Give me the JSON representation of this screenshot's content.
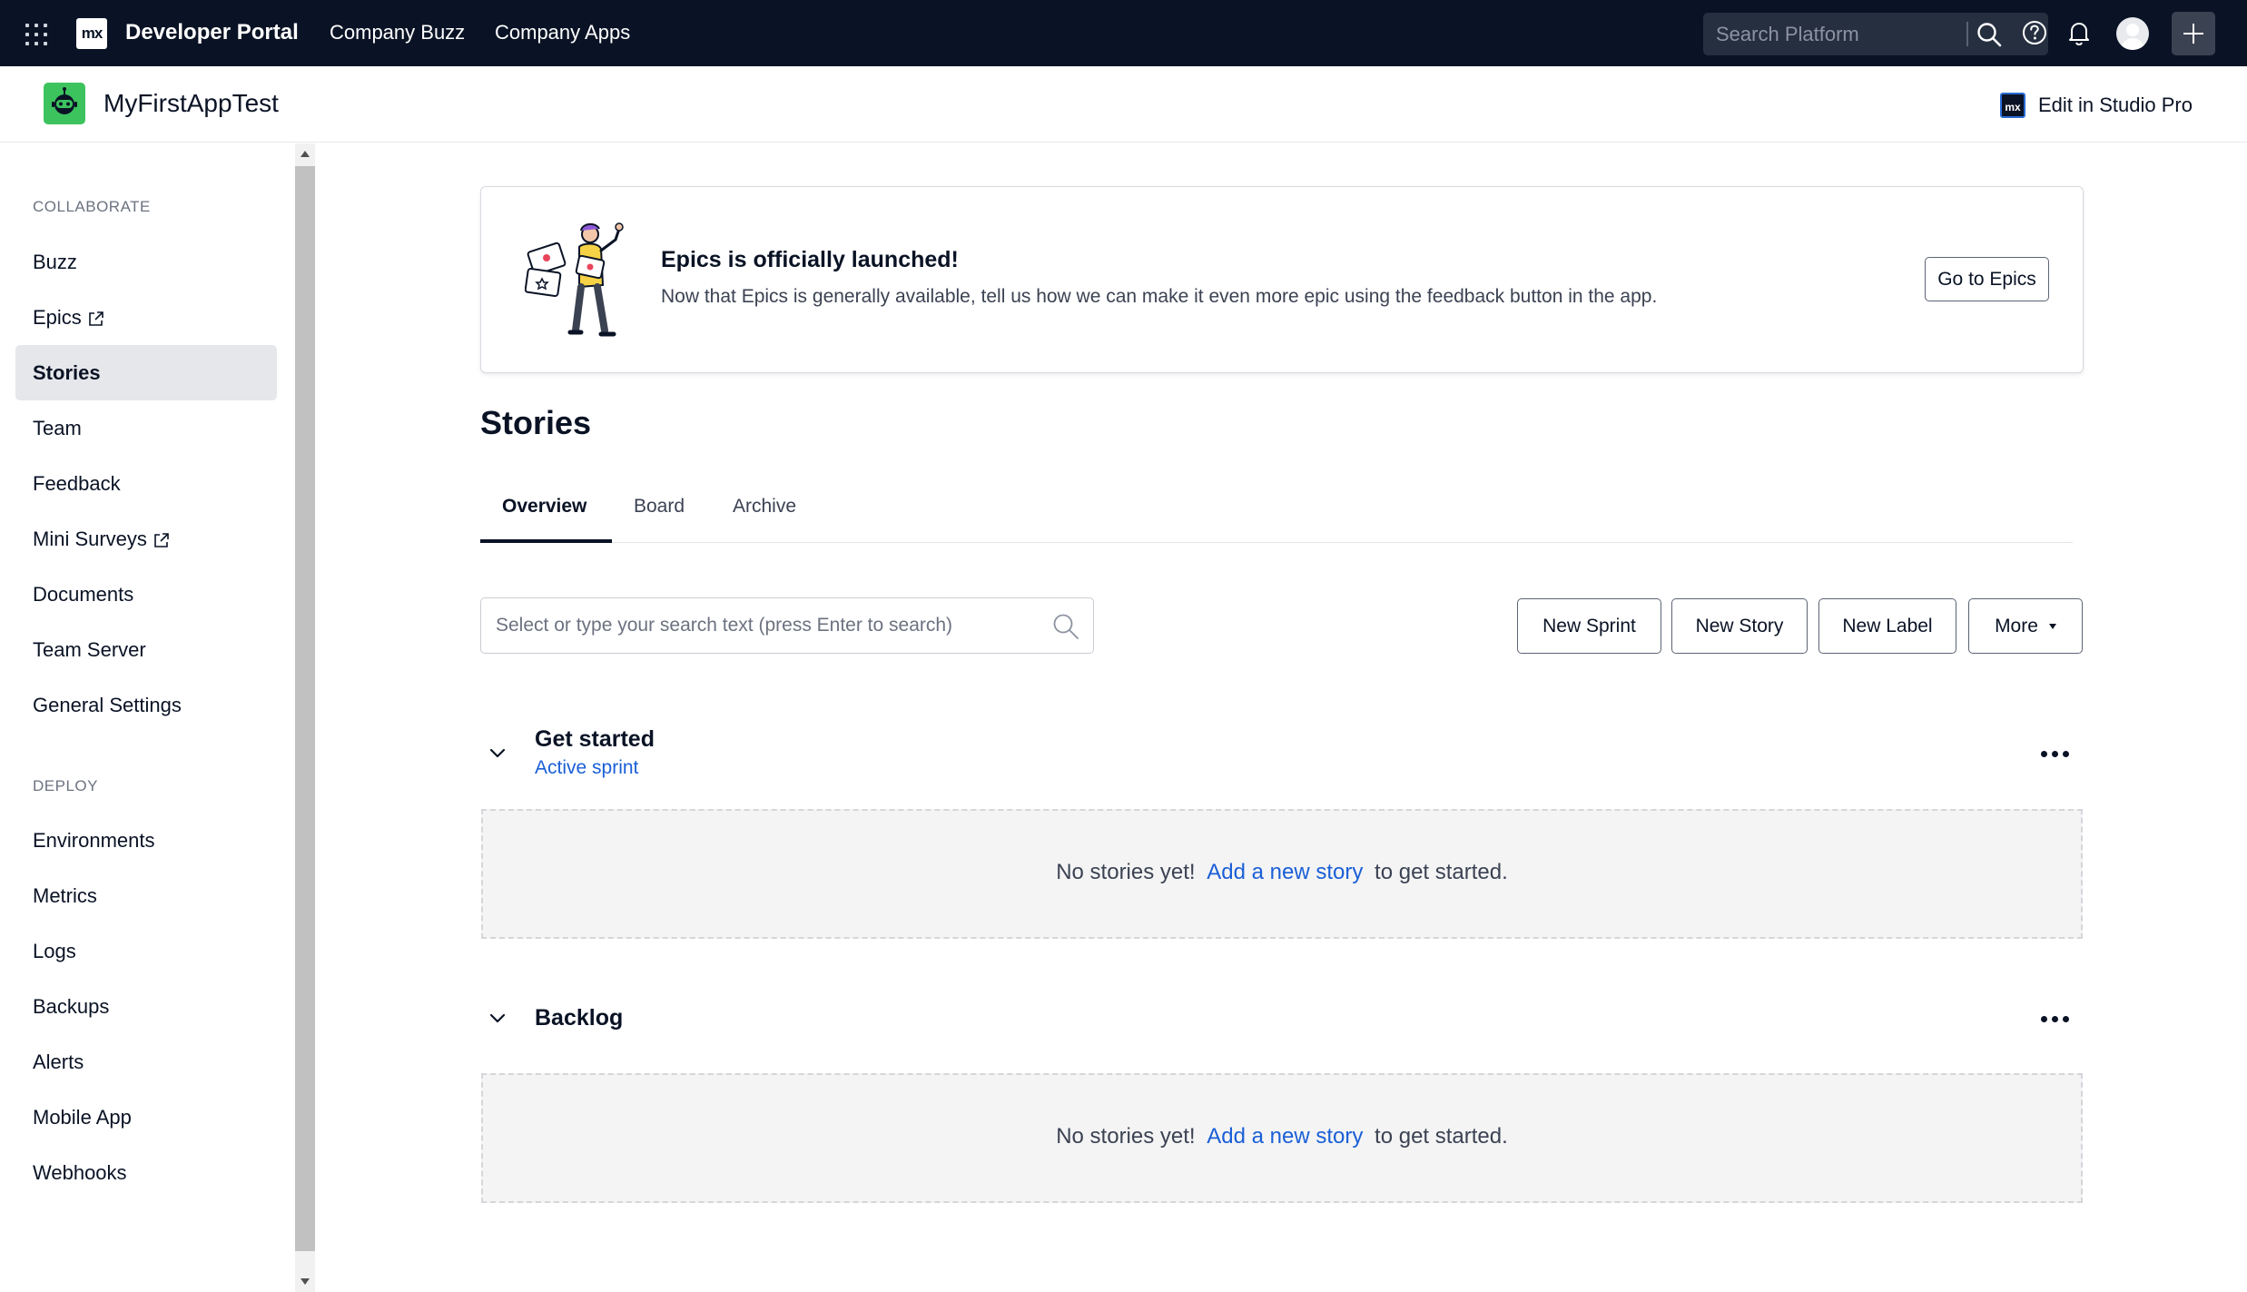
{
  "topbar": {
    "portal_title": "Developer Portal",
    "logo_text": "mx",
    "nav_links": [
      "Company Buzz",
      "Company Apps"
    ],
    "search_placeholder": "Search Platform",
    "icons": [
      "apps-grid-icon",
      "search-icon",
      "help-icon",
      "bell-icon",
      "avatar",
      "plus-icon"
    ]
  },
  "app": {
    "name": "MyFirstAppTest",
    "studio_link": "Edit in Studio Pro",
    "studio_logo_text": "mx"
  },
  "sidebar": {
    "sections": [
      {
        "title": "COLLABORATE",
        "items": [
          {
            "label": "Buzz",
            "external": false,
            "active": false
          },
          {
            "label": "Epics",
            "external": true,
            "active": false
          },
          {
            "label": "Stories",
            "external": false,
            "active": true
          },
          {
            "label": "Team",
            "external": false,
            "active": false
          },
          {
            "label": "Feedback",
            "external": false,
            "active": false
          },
          {
            "label": "Mini Surveys",
            "external": true,
            "active": false
          },
          {
            "label": "Documents",
            "external": false,
            "active": false
          },
          {
            "label": "Team Server",
            "external": false,
            "active": false
          },
          {
            "label": "General Settings",
            "external": false,
            "active": false
          }
        ]
      },
      {
        "title": "DEPLOY",
        "items": [
          {
            "label": "Environments"
          },
          {
            "label": "Metrics"
          },
          {
            "label": "Logs"
          },
          {
            "label": "Backups"
          },
          {
            "label": "Alerts"
          },
          {
            "label": "Mobile App"
          },
          {
            "label": "Webhooks"
          }
        ]
      }
    ]
  },
  "banner": {
    "title": "Epics is officially launched!",
    "text": "Now that Epics is generally available, tell us how we can make it even more epic using the feedback button in the app.",
    "button": "Go to Epics"
  },
  "page": {
    "title": "Stories",
    "tabs": [
      "Overview",
      "Board",
      "Archive"
    ],
    "active_tab": "Overview",
    "search_placeholder": "Select or type your search text (press Enter to search)",
    "actions": [
      "New Sprint",
      "New Story",
      "New Label",
      "More"
    ]
  },
  "sections": [
    {
      "title": "Get started",
      "subtitle": "Active sprint",
      "empty_prefix": "No stories yet!",
      "empty_link": "Add a new story",
      "empty_suffix": "to get started."
    },
    {
      "title": "Backlog",
      "subtitle": "",
      "empty_prefix": "No stories yet!",
      "empty_link": "Add a new story",
      "empty_suffix": "to get started."
    }
  ],
  "colors": {
    "topbar_bg": "#0a1325",
    "app_icon": "#3cc35e",
    "link": "#1a5fd6",
    "active_nav_bg": "#e6e7ea"
  }
}
